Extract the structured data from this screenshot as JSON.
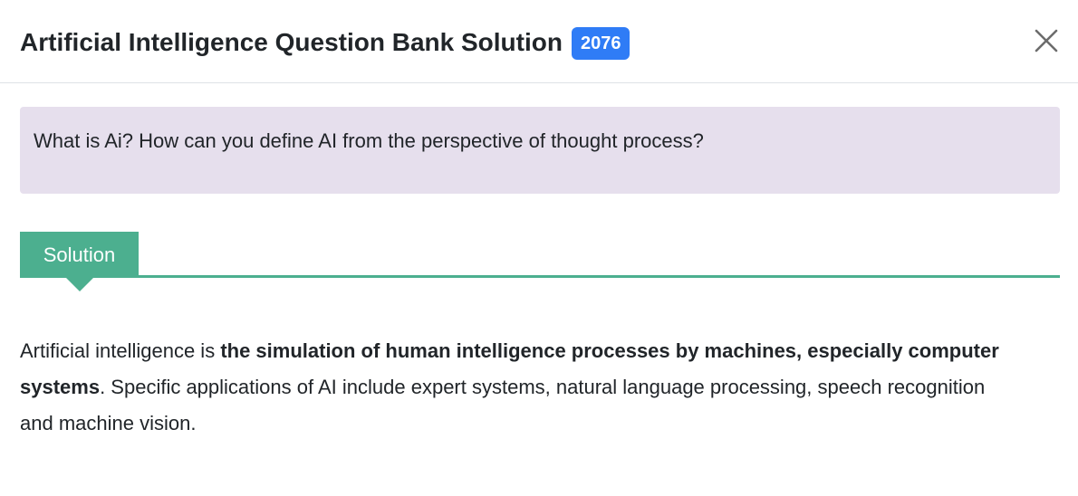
{
  "header": {
    "title": "Artificial Intelligence Question Bank Solution",
    "year_badge": "2076",
    "close_icon": "close-icon"
  },
  "question": {
    "text": "What is Ai? How can you define AI from the perspective of thought process?"
  },
  "solution": {
    "tab_label": "Solution",
    "answer": {
      "intro": "Artificial intelligence is ",
      "bold": "the simulation of human intelligence processes by machines, especially computer systems",
      "rest": ". Specific applications of AI include expert systems, natural language processing, speech recognition and machine vision."
    }
  },
  "colors": {
    "badge": "#2f7cf6",
    "question_bg": "#e6dfed",
    "solution_accent": "#4caf8f"
  }
}
